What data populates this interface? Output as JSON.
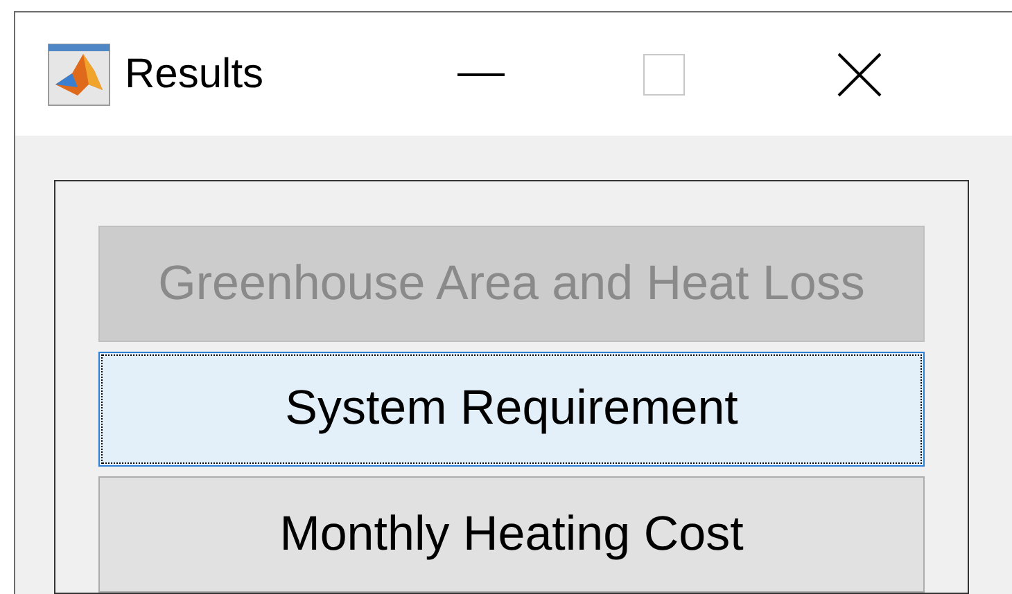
{
  "window": {
    "title": "Results"
  },
  "buttons": [
    {
      "label": "Greenhouse Area and Heat Loss",
      "disabled": true,
      "focused": false
    },
    {
      "label": "System Requirement",
      "disabled": false,
      "focused": true
    },
    {
      "label": "Monthly Heating Cost",
      "disabled": false,
      "focused": false
    }
  ]
}
